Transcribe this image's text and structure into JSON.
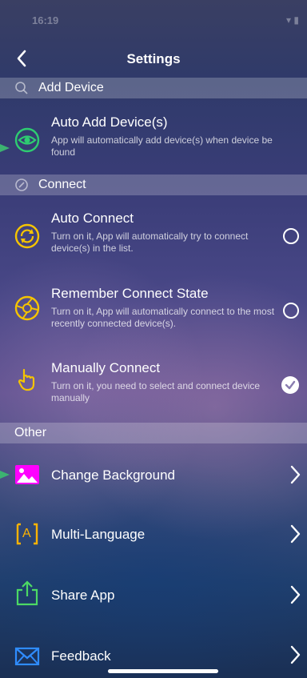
{
  "status": {
    "time": "16:19",
    "indicators": "▾ ▮"
  },
  "nav": {
    "title": "Settings"
  },
  "sections": {
    "add_device": "Add Device",
    "connect": "Connect",
    "other": "Other"
  },
  "add_device": {
    "auto_add": {
      "title": "Auto Add Device(s)",
      "desc": "App will automatically add device(s) when device be found"
    }
  },
  "connect": {
    "auto_connect": {
      "title": "Auto Connect",
      "desc": "Turn on it, App will automatically try to connect device(s) in the list.",
      "checked": false
    },
    "remember": {
      "title": "Remember Connect State",
      "desc": "Turn on it, App will automatically connect to the most recently connected device(s).",
      "checked": false
    },
    "manual": {
      "title": "Manually Connect",
      "desc": "Turn on it, you need to select and connect device manually",
      "checked": true
    }
  },
  "other": {
    "change_bg": "Change Background",
    "language": "Multi-Language",
    "share": "Share App",
    "feedback": "Feedback",
    "language_icon_text": "A"
  },
  "colors": {
    "green": "#2ecc71",
    "yellow": "#f5c400",
    "magenta": "#ff00ff",
    "lang": "#ffb300",
    "share": "#4cd964",
    "mail": "#2f8cff"
  }
}
